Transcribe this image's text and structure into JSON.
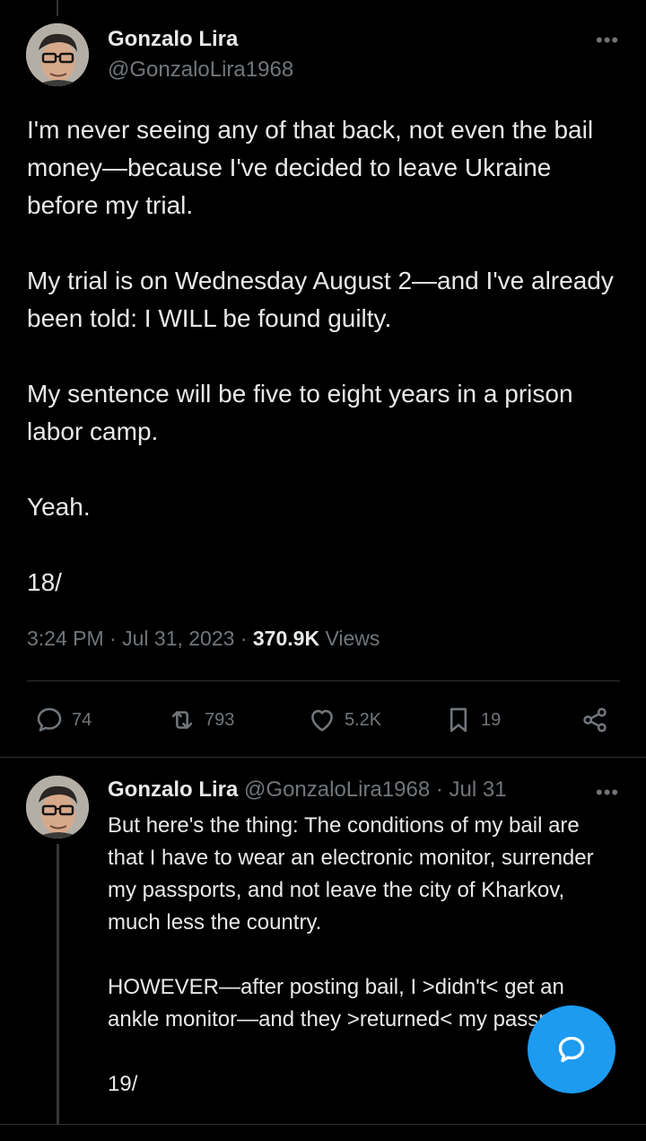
{
  "tweet": {
    "author_name": "Gonzalo Lira",
    "author_handle": "@GonzaloLira1968",
    "more_label": "•••",
    "paragraphs": [
      "I'm never seeing any of that back, not even the bail money—because I've decided to leave Ukraine before my trial.",
      "My trial is on Wednesday August 2—and I've already been told: I WILL be found guilty.",
      "My sentence will be five to eight years in a prison labor camp.",
      "Yeah.",
      "18/"
    ],
    "time": "3:24 PM",
    "date": "Jul 31, 2023",
    "separator": "·",
    "views_count": "370.9K",
    "views_label": "Views",
    "actions": {
      "replies": "74",
      "reposts": "793",
      "likes": "5.2K",
      "bookmarks": "19"
    }
  },
  "reply": {
    "author_name": "Gonzalo Lira",
    "author_handle": "@GonzaloLira1968",
    "separator": "·",
    "date": "Jul 31",
    "more_label": "•••",
    "paragraphs": [
      "But here's the thing: The conditions of my bail are that I have to wear an electronic monitor, surrender my passports, and not leave the city of Kharkov, much less the country.",
      "HOWEVER—after posting bail, I >didn't< get an ankle monitor—and they >returned< my passports.",
      "19/"
    ]
  },
  "colors": {
    "background": "#000000",
    "text": "#e7e9ea",
    "secondary": "#71767b",
    "accent": "#1d9bf0",
    "border": "#2f3336"
  },
  "icons": {
    "reply": "reply-icon",
    "repost": "repost-icon",
    "like": "heart-icon",
    "bookmark": "bookmark-icon",
    "share": "share-icon",
    "compose": "compose-icon"
  }
}
